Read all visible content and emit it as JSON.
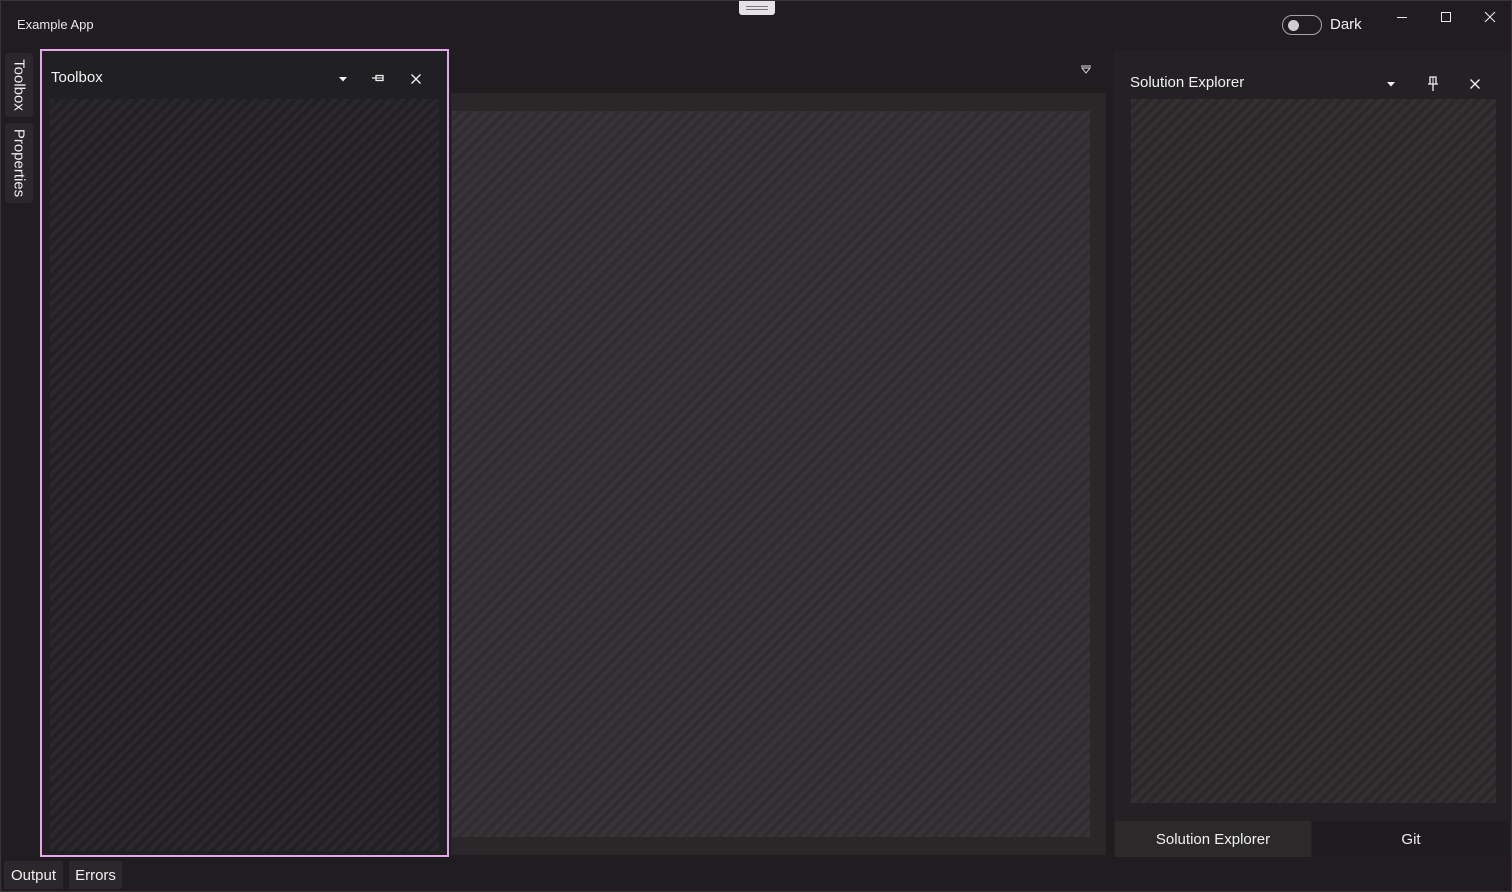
{
  "app": {
    "title": "Example App"
  },
  "theme_toggle": {
    "label": "Dark",
    "on": false
  },
  "window_controls": {
    "minimize": "minimize-icon",
    "maximize": "maximize-icon",
    "close": "close-icon"
  },
  "side_tabs": [
    "Toolbox",
    "Properties"
  ],
  "toolbox": {
    "title": "Toolbox",
    "icons": [
      "dropdown-icon",
      "pin-icon",
      "close-icon"
    ]
  },
  "solution_explorer": {
    "title": "Solution Explorer",
    "icons": [
      "dropdown-icon",
      "pin-icon",
      "close-icon"
    ],
    "tabs": [
      "Solution Explorer",
      "Git"
    ],
    "selected_tab": "Git"
  },
  "bottom_tabs": [
    "Output",
    "Errors"
  ],
  "colors": {
    "accent_border": "#e6a6ea",
    "background": "#201c20"
  }
}
